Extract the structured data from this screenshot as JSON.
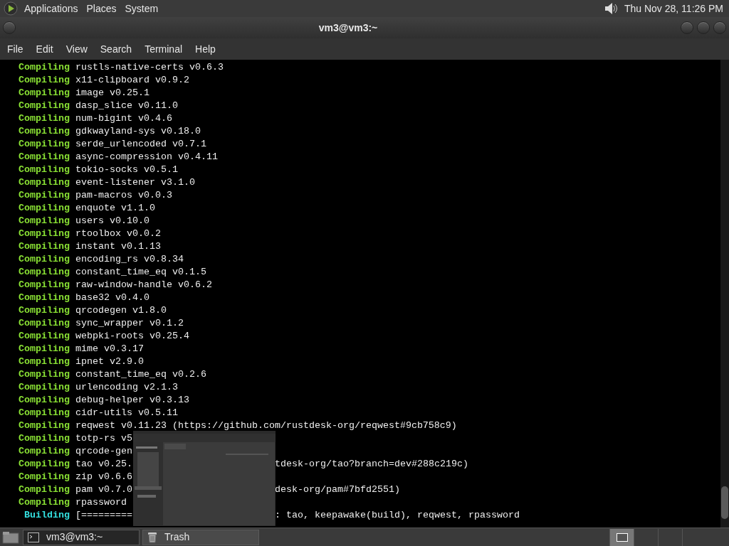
{
  "top_panel": {
    "menus": [
      "Applications",
      "Places",
      "System"
    ],
    "clock": "Thu Nov 28, 11:26 PM"
  },
  "window": {
    "title": "vm3@vm3:~"
  },
  "menu_bar": [
    "File",
    "Edit",
    "View",
    "Search",
    "Terminal",
    "Help"
  ],
  "terminal": {
    "lines": [
      {
        "kind": "compiling",
        "status": "Compiling",
        "text": "rustls-native-certs v0.6.3"
      },
      {
        "kind": "compiling",
        "status": "Compiling",
        "text": "x11-clipboard v0.9.2"
      },
      {
        "kind": "compiling",
        "status": "Compiling",
        "text": "image v0.25.1"
      },
      {
        "kind": "compiling",
        "status": "Compiling",
        "text": "dasp_slice v0.11.0"
      },
      {
        "kind": "compiling",
        "status": "Compiling",
        "text": "num-bigint v0.4.6"
      },
      {
        "kind": "compiling",
        "status": "Compiling",
        "text": "gdkwayland-sys v0.18.0"
      },
      {
        "kind": "compiling",
        "status": "Compiling",
        "text": "serde_urlencoded v0.7.1"
      },
      {
        "kind": "compiling",
        "status": "Compiling",
        "text": "async-compression v0.4.11"
      },
      {
        "kind": "compiling",
        "status": "Compiling",
        "text": "tokio-socks v0.5.1"
      },
      {
        "kind": "compiling",
        "status": "Compiling",
        "text": "event-listener v3.1.0"
      },
      {
        "kind": "compiling",
        "status": "Compiling",
        "text": "pam-macros v0.0.3"
      },
      {
        "kind": "compiling",
        "status": "Compiling",
        "text": "enquote v1.1.0"
      },
      {
        "kind": "compiling",
        "status": "Compiling",
        "text": "users v0.10.0"
      },
      {
        "kind": "compiling",
        "status": "Compiling",
        "text": "rtoolbox v0.0.2"
      },
      {
        "kind": "compiling",
        "status": "Compiling",
        "text": "instant v0.1.13"
      },
      {
        "kind": "compiling",
        "status": "Compiling",
        "text": "encoding_rs v0.8.34"
      },
      {
        "kind": "compiling",
        "status": "Compiling",
        "text": "constant_time_eq v0.1.5"
      },
      {
        "kind": "compiling",
        "status": "Compiling",
        "text": "raw-window-handle v0.6.2"
      },
      {
        "kind": "compiling",
        "status": "Compiling",
        "text": "base32 v0.4.0"
      },
      {
        "kind": "compiling",
        "status": "Compiling",
        "text": "qrcodegen v1.8.0"
      },
      {
        "kind": "compiling",
        "status": "Compiling",
        "text": "sync_wrapper v0.1.2"
      },
      {
        "kind": "compiling",
        "status": "Compiling",
        "text": "webpki-roots v0.25.4"
      },
      {
        "kind": "compiling",
        "status": "Compiling",
        "text": "mime v0.3.17"
      },
      {
        "kind": "compiling",
        "status": "Compiling",
        "text": "ipnet v2.9.0"
      },
      {
        "kind": "compiling",
        "status": "Compiling",
        "text": "constant_time_eq v0.2.6"
      },
      {
        "kind": "compiling",
        "status": "Compiling",
        "text": "urlencoding v2.1.3"
      },
      {
        "kind": "compiling",
        "status": "Compiling",
        "text": "debug-helper v0.3.13"
      },
      {
        "kind": "compiling",
        "status": "Compiling",
        "text": "cidr-utils v0.5.11"
      },
      {
        "kind": "compiling",
        "status": "Compiling",
        "text": "reqwest v0.11.23 (https://github.com/rustdesk-org/reqwest#9cb758c9)"
      },
      {
        "kind": "compiling",
        "status": "Compiling",
        "text": "totp-rs v5"
      },
      {
        "kind": "compiling",
        "status": "Compiling",
        "text": "qrcode-gen"
      },
      {
        "kind": "compiling",
        "status": "Compiling",
        "text": "tao v0.25.",
        "rest": "tdesk-org/tao?branch=dev#288c219c)"
      },
      {
        "kind": "compiling",
        "status": "Compiling",
        "text": "zip v0.6.6"
      },
      {
        "kind": "compiling",
        "status": "Compiling",
        "text": "pam v0.7.0",
        "rest": "desk-org/pam#7bfd2551)"
      },
      {
        "kind": "compiling",
        "status": "Compiling",
        "text": "rpassword"
      },
      {
        "kind": "building",
        "status": "Building",
        "text": "[=========",
        "rest": ": tao, keepawake(build), reqwest, rpassword"
      }
    ]
  },
  "taskbar": {
    "tasks": [
      {
        "label": "vm3@vm3:~",
        "kind": "terminal",
        "selected": true
      },
      {
        "label": "Trash",
        "kind": "trash",
        "selected": false
      }
    ],
    "workspaces": [
      {
        "selected": true
      },
      {
        "selected": false
      },
      {
        "selected": false
      },
      {
        "selected": false
      }
    ]
  }
}
